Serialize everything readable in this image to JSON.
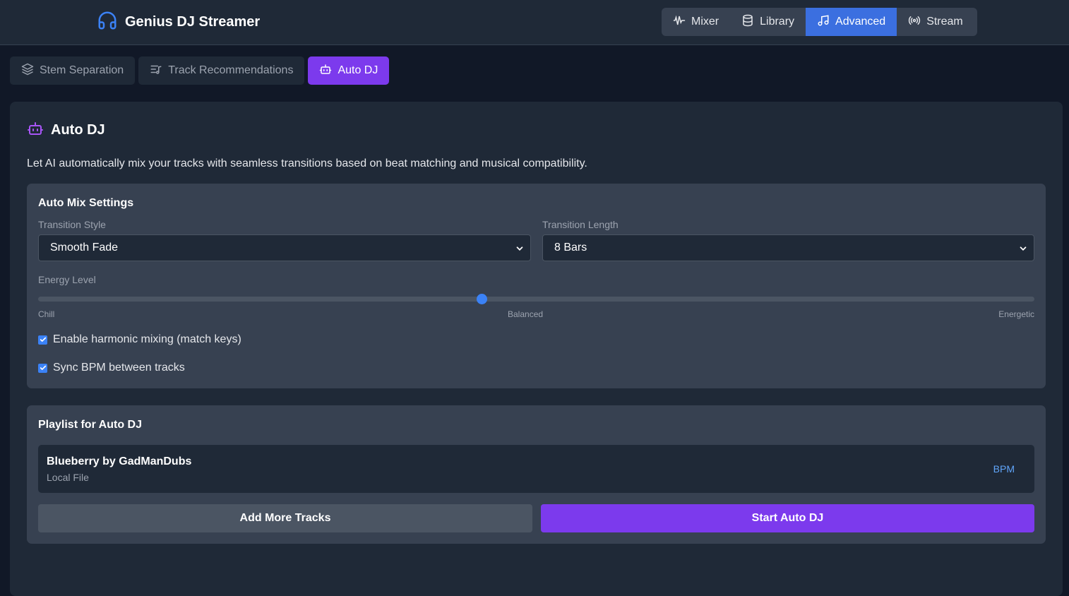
{
  "app": {
    "title": "Genius DJ Streamer",
    "accent_color": "#3b6fe0",
    "brand_color": "#3b82f6",
    "auto_dj_color": "#7c3aed"
  },
  "nav": {
    "items": [
      {
        "label": "Mixer",
        "icon": "waveform-icon",
        "active": false
      },
      {
        "label": "Library",
        "icon": "database-icon",
        "active": false
      },
      {
        "label": "Advanced",
        "icon": "music-note-icon",
        "active": true
      },
      {
        "label": "Stream",
        "icon": "broadcast-icon",
        "active": false
      }
    ]
  },
  "subtabs": {
    "items": [
      {
        "label": "Stem Separation",
        "icon": "layers-icon",
        "active": false
      },
      {
        "label": "Track Recommendations",
        "icon": "playlist-icon",
        "active": false
      },
      {
        "label": "Auto DJ",
        "icon": "robot-icon",
        "active": true
      }
    ]
  },
  "auto_dj": {
    "title": "Auto DJ",
    "description": "Let AI automatically mix your tracks with seamless transitions based on beat matching and musical compatibility.",
    "settings": {
      "title": "Auto Mix Settings",
      "transition_style": {
        "label": "Transition Style",
        "value": "Smooth Fade"
      },
      "transition_length": {
        "label": "Transition Length",
        "value": "8 Bars"
      },
      "energy": {
        "label": "Energy Level",
        "value_fraction": 0.445,
        "min_label": "Chill",
        "mid_label": "Balanced",
        "max_label": "Energetic"
      },
      "harmonic": {
        "label": "Enable harmonic mixing (match keys)",
        "checked": true
      },
      "sync_bpm": {
        "label": "Sync BPM between tracks",
        "checked": true
      }
    },
    "playlist": {
      "title": "Playlist for Auto DJ",
      "tracks": [
        {
          "title": "Blueberry by GadManDubs",
          "source": "Local File",
          "bpm": "BPM"
        }
      ],
      "add_label": "Add More Tracks",
      "start_label": "Start Auto DJ"
    }
  }
}
